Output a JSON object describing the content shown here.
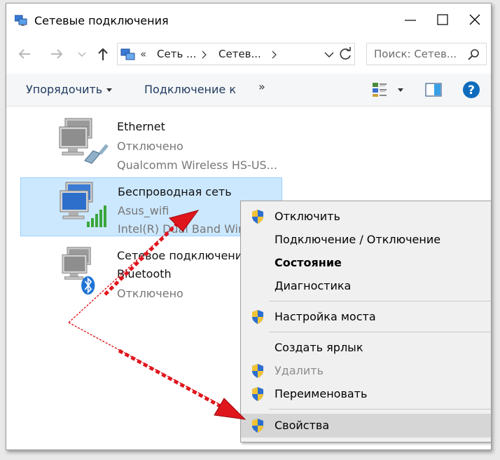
{
  "window": {
    "title": "Сетевые подключения"
  },
  "address_bar": {
    "prefix": "«",
    "crumbs": [
      "Сеть ...",
      "Сетев..."
    ],
    "search_placeholder": "Поиск: Сетев..."
  },
  "toolbar": {
    "organize_label": "Упорядочить",
    "connect_label": "Подключение к",
    "more_label": "»"
  },
  "connections": [
    {
      "name": "Ethernet",
      "status": "Отключено",
      "device": "Qualcomm Wireless HS-US..."
    },
    {
      "name": "Беспроводная сеть",
      "status": "Asus_wifi",
      "device": "Intel(R) Dual Band Wire"
    },
    {
      "name": "Сетевое подключение",
      "status": "Bluetooth",
      "device": "Отключено"
    }
  ],
  "context_menu": {
    "items": [
      {
        "label": "Отключить",
        "shield": true
      },
      {
        "label": "Подключение / Отключение",
        "shield": false
      },
      {
        "label": "Состояние",
        "shield": false
      },
      {
        "label": "Диагностика",
        "shield": false
      },
      {
        "label": "Настройка моста",
        "shield": true
      },
      {
        "label": "Создать ярлык",
        "shield": false
      },
      {
        "label": "Удалить",
        "shield": true
      },
      {
        "label": "Переименовать",
        "shield": true
      },
      {
        "label": "Свойства",
        "shield": true
      }
    ]
  },
  "colors": {
    "selection": "#cce8ff",
    "arrow_red": "#e0161d",
    "help_blue": "#0f6cbd"
  }
}
